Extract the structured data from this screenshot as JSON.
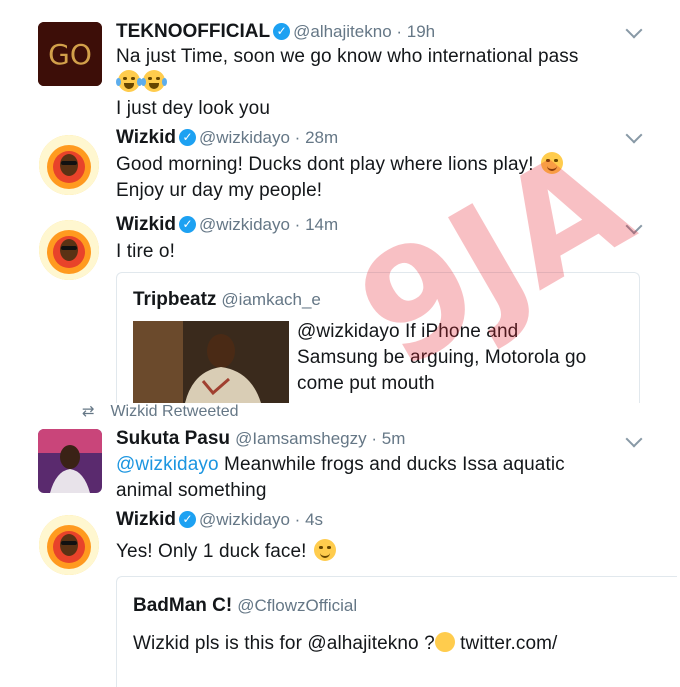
{
  "tweets": [
    {
      "name": "TEKNOOFFICIAL",
      "handle": "@alhajitekno",
      "time": "19h",
      "lines": [
        "Na just Time, soon we go know who international pass",
        "",
        "I just dey look you"
      ],
      "avatar_text": "GO"
    },
    {
      "name": "Wizkid",
      "handle": "@wizkidayo",
      "time": "28m",
      "lines": [
        "Good morning! Ducks dont play where lions play!",
        "Enjoy ur day my people!"
      ]
    },
    {
      "name": "Wizkid",
      "handle": "@wizkidayo",
      "time": "14m",
      "lines": [
        "I tire o!"
      ],
      "quote": {
        "name": "Tripbeatz",
        "handle": "@iamkach_e",
        "lines": [
          "@wizkidayo If iPhone and",
          "Samsung be arguing, Motorola go",
          "come put mouth"
        ]
      }
    },
    {
      "retweet_label": "Wizkid Retweeted",
      "name": "Sukuta Pasu",
      "handle": "@Iamsamshegzy",
      "time": "5m",
      "mention": "@wizkidayo",
      "line1_rest": " Meanwhile frogs and ducks Issa aquatic",
      "line2": "animal something"
    },
    {
      "name": "Wizkid",
      "handle": "@wizkidayo",
      "time": "4s",
      "lines": [
        "Yes! Only 1 duck face!"
      ],
      "quote": {
        "name": "BadMan C!",
        "handle": "@CflowzOfficial",
        "text": "Wizkid pls is this for @alhajitekno ?",
        "text_tail": " twitter.com/"
      }
    }
  ],
  "watermark": "9JA",
  "colors": {
    "accent": "#1da1f2",
    "link": "#1b95e0",
    "muted": "#657786",
    "watermark": "#e8222e"
  }
}
